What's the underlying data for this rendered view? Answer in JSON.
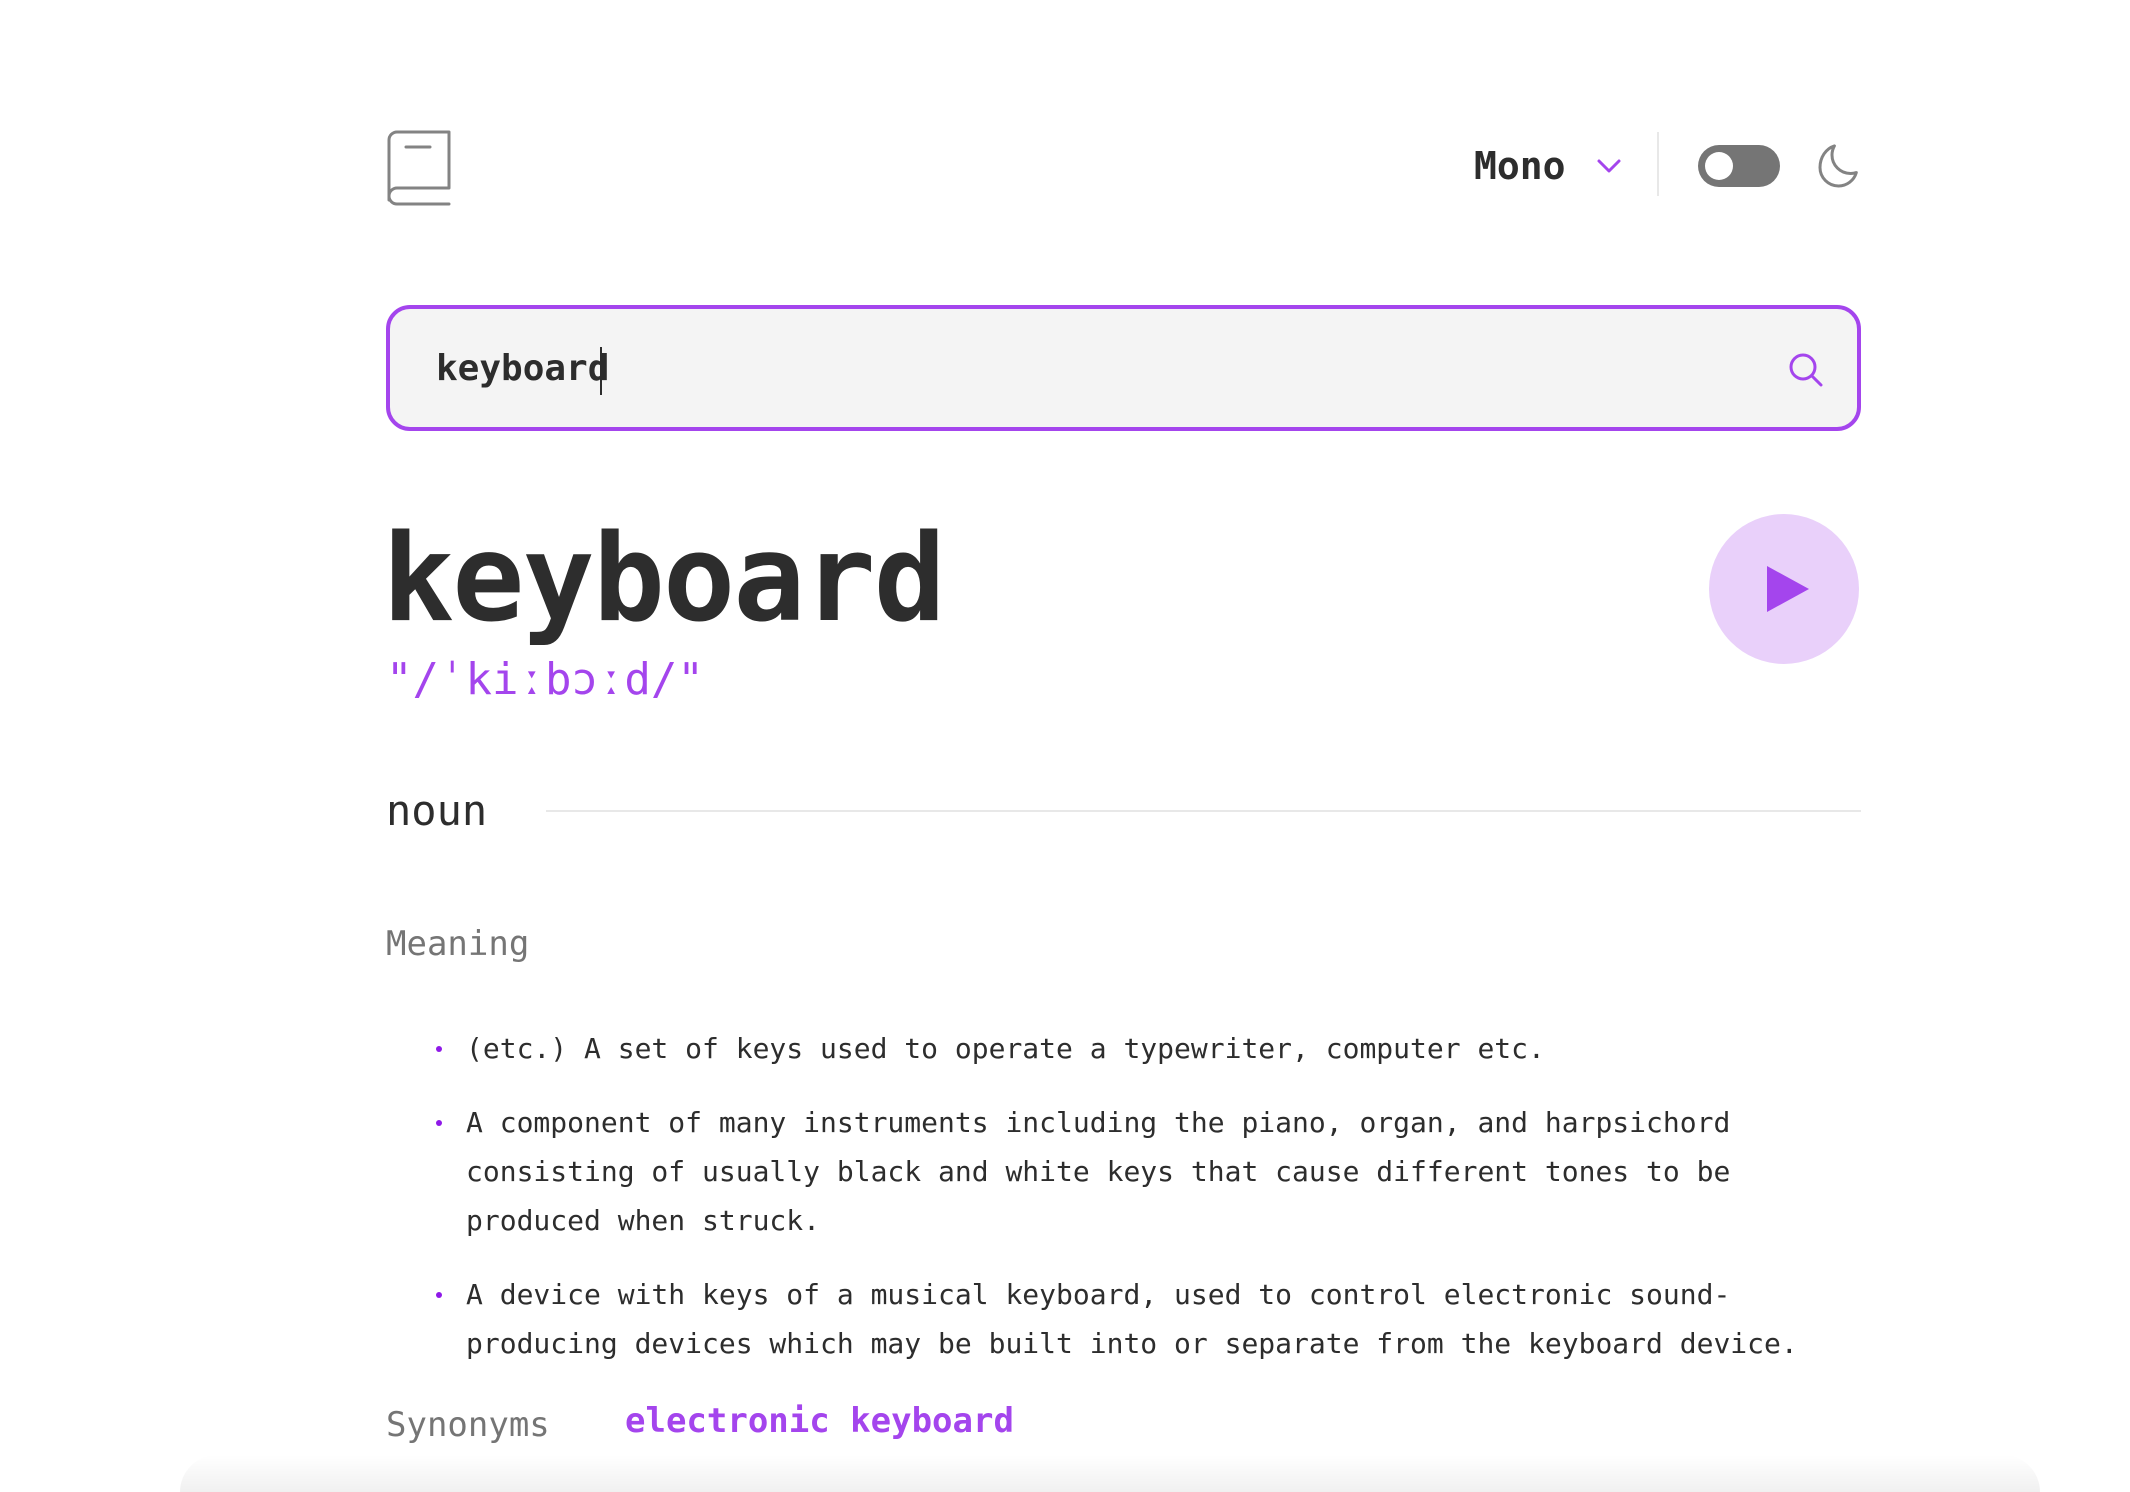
{
  "header": {
    "logo_icon": "book-icon",
    "font_selector": {
      "value": "Mono",
      "icon": "chevron-down-icon"
    },
    "theme_toggle": {
      "state": "off",
      "icon": "moon-icon"
    }
  },
  "search": {
    "value": "keyboard",
    "icon": "search-icon"
  },
  "entry": {
    "word": "keyboard",
    "phonetic": "\"/ˈkiːbɔːd/\"",
    "play_icon": "play-icon",
    "part_of_speech": "noun",
    "meaning_heading": "Meaning",
    "definitions": [
      " (etc.) A set of keys used to operate a typewriter, computer etc.",
      " A component of many instruments including the piano, organ, and harpsichord consisting of usually black and white keys that cause different tones to be produced when struck.",
      " A device with keys of a musical keyboard, used to control electronic sound-producing devices which may be built into or separate from the keyboard device."
    ],
    "synonyms_label": "Synonyms",
    "synonyms": [
      "electronic keyboard"
    ]
  },
  "colors": {
    "accent": "#a445ed",
    "text": "#2d2d2d",
    "muted": "#757575",
    "search_bg": "#f4f4f4",
    "play_bg": "#e9d0fa"
  }
}
